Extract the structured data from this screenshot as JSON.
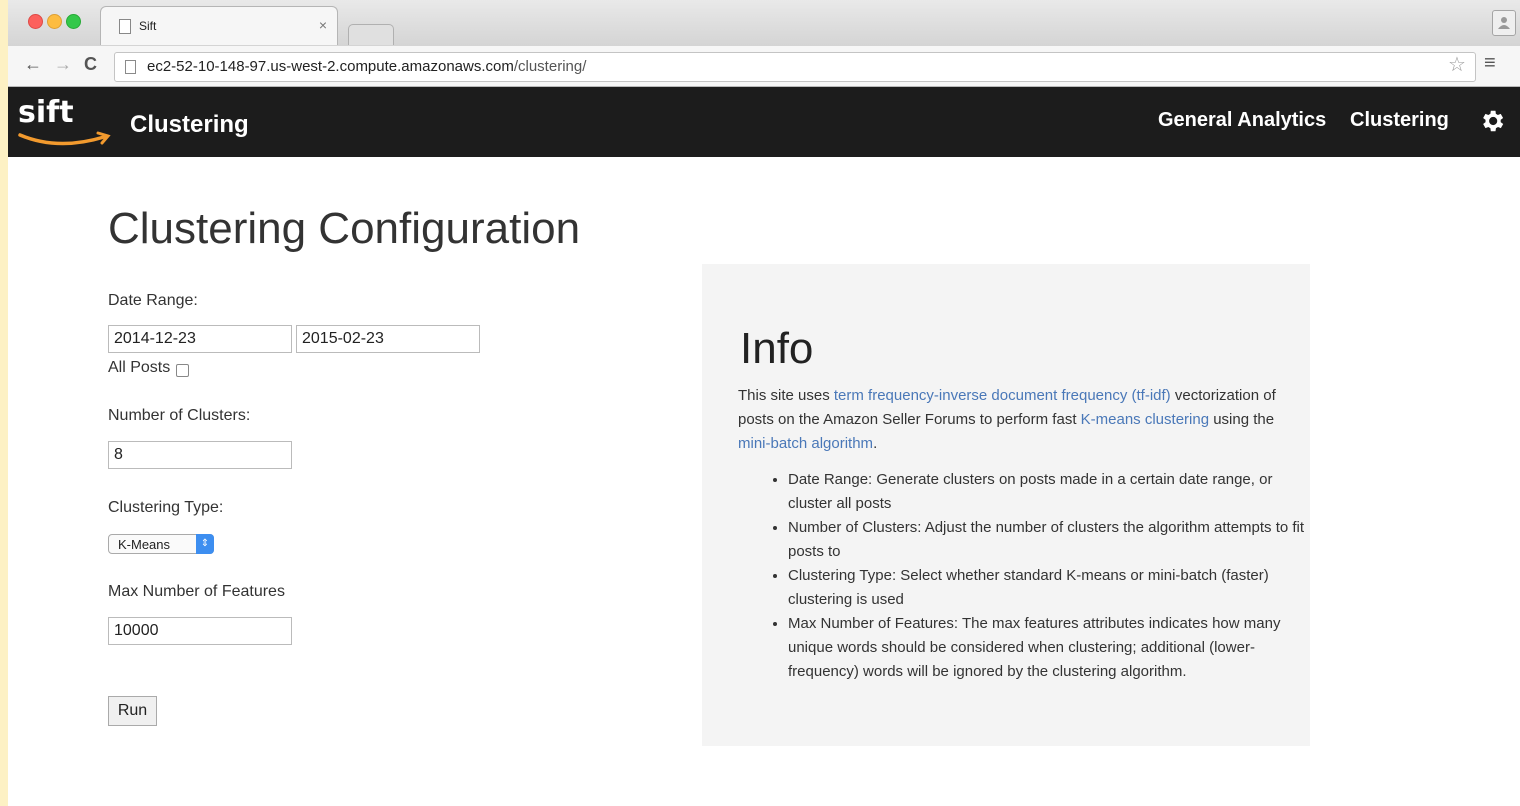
{
  "browser": {
    "tab_title": "Sift",
    "tab_close": "×",
    "url_host": "ec2-52-10-148-97.us-west-2.compute.amazonaws.com",
    "url_path": "/clustering/",
    "back_icon": "←",
    "forward_icon": "→",
    "reload_icon": "C",
    "star_icon": "☆",
    "menu_icon": "≡",
    "profile_icon": "👤"
  },
  "navbar": {
    "brand": "sift",
    "title": "Clustering",
    "links": [
      "General Analytics",
      "Clustering"
    ]
  },
  "form": {
    "heading": "Clustering Configuration",
    "date_range_label": "Date Range:",
    "start_date": "2014-12-23",
    "end_date": "2015-02-23",
    "all_posts_label": "All Posts",
    "all_posts_checked": false,
    "num_clusters_label": "Number of Clusters:",
    "num_clusters": "8",
    "clustering_type_label": "Clustering Type:",
    "clustering_type": "K-Means",
    "max_features_label": "Max Number of Features",
    "max_features": "10000",
    "run_label": "Run"
  },
  "info": {
    "title": "Info",
    "desc_1": "This site uses ",
    "link_tfidf": "term frequency-inverse document frequency (tf-idf)",
    "desc_2": " vectorization of posts on the Amazon Seller Forums to perform fast ",
    "link_kmeans": "K-means clustering",
    "desc_3": " using the ",
    "link_minibatch": "mini-batch algorithm",
    "desc_4": ".",
    "items": [
      "Date Range: Generate clusters on posts made in a certain date range, or cluster all posts",
      "Number of Clusters: Adjust the number of clusters the algorithm attempts to fit posts to",
      "Clustering Type: Select whether standard K-means or mini-batch (faster) clustering is used",
      "Max Number of Features: The max features attributes indicates how many unique words should be considered when clustering; additional (lower-frequency) words will be ignored by the clustering algorithm."
    ]
  },
  "colors": {
    "navbar_bg": "#1c1c1c",
    "link": "#4a78b8",
    "info_bg": "#f4f4f4",
    "brand_smile": "#f29a2e"
  }
}
